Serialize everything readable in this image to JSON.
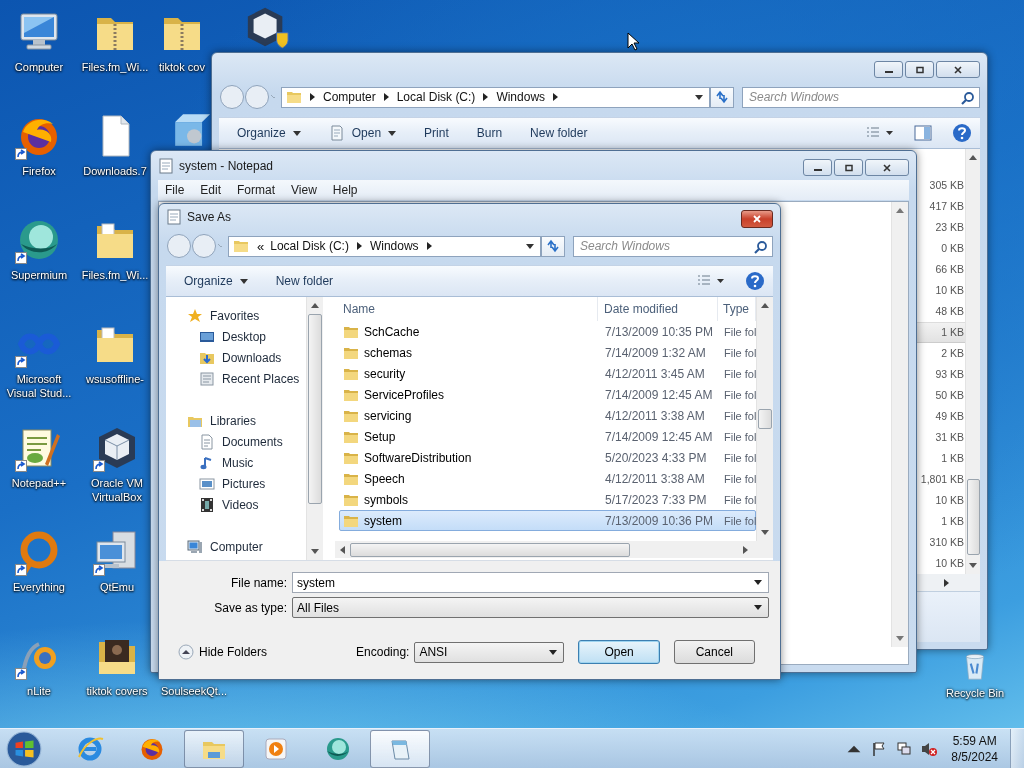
{
  "desktop_icons": [
    {
      "label": "Computer",
      "kind": "computer",
      "shortcut": false
    },
    {
      "label": "Firefox",
      "kind": "firefox",
      "shortcut": true
    },
    {
      "label": "Supermium",
      "kind": "supermium",
      "shortcut": true
    },
    {
      "label": "Microsoft Visual Stud...",
      "kind": "vs",
      "shortcut": true
    },
    {
      "label": "Notepad++",
      "kind": "notepadpp",
      "shortcut": true
    },
    {
      "label": "Everything",
      "kind": "everything",
      "shortcut": true
    },
    {
      "label": "nLite",
      "kind": "nlite",
      "shortcut": true
    },
    {
      "label": "Files.fm_Wi...",
      "kind": "zip-folder",
      "shortcut": false
    },
    {
      "label": "Downloads.7",
      "kind": "file",
      "shortcut": false
    },
    {
      "label": "Files.fm_Wi...",
      "kind": "folder",
      "shortcut": false
    },
    {
      "label": "wsusoffline-",
      "kind": "folder",
      "shortcut": false
    },
    {
      "label": "Oracle VM VirtualBox",
      "kind": "virtualbox",
      "shortcut": true
    },
    {
      "label": "QtEmu",
      "kind": "qtemu",
      "shortcut": true
    },
    {
      "label": "tiktok covers",
      "kind": "photo-folder",
      "shortcut": false
    },
    {
      "label": "tiktok cov",
      "kind": "zip-folder",
      "shortcut": false
    },
    {
      "kind": "installer",
      "shortcut": false
    },
    {
      "label": "SoulseekQt..."
    },
    {
      "kind": "cube-shield",
      "shortcut": false
    },
    {
      "label": "Recycle Bin",
      "kind": "recycle-bin",
      "shortcut": false
    }
  ],
  "explorer": {
    "breadcrumb": [
      "Computer",
      "Local Disk (C:)",
      "Windows"
    ],
    "search_placeholder": "Search Windows",
    "toolbar": [
      {
        "label": "Organize",
        "dropdown": true,
        "icon": false
      },
      {
        "label": "Open",
        "dropdown": true,
        "icon": true
      },
      {
        "label": "Print",
        "dropdown": false,
        "icon": false
      },
      {
        "label": "Burn",
        "dropdown": false,
        "icon": false
      },
      {
        "label": "New folder",
        "dropdown": false,
        "icon": false
      }
    ],
    "sizes": [
      {
        "text": "305 KB",
        "selected": false
      },
      {
        "text": "417 KB",
        "selected": false
      },
      {
        "text": "23 KB",
        "selected": false
      },
      {
        "text": "0 KB",
        "selected": false
      },
      {
        "text": "66 KB",
        "selected": false
      },
      {
        "text": "10 KB",
        "selected": false
      },
      {
        "text": "48 KB",
        "selected": false
      },
      {
        "text": "1 KB",
        "selected": true
      },
      {
        "text": "2 KB",
        "selected": false
      },
      {
        "text": "93 KB",
        "selected": false
      },
      {
        "text": "50 KB",
        "selected": false
      },
      {
        "text": "49 KB",
        "selected": false
      },
      {
        "text": "31 KB",
        "selected": false
      },
      {
        "text": "1 KB",
        "selected": false
      },
      {
        "text": "1,801 KB",
        "selected": false
      },
      {
        "text": "10 KB",
        "selected": false
      },
      {
        "text": "1 KB",
        "selected": false
      },
      {
        "text": "310 KB",
        "selected": false
      },
      {
        "text": "10 KB",
        "selected": false
      }
    ]
  },
  "notepad": {
    "title": "system - Notepad",
    "menu": [
      "File",
      "Edit",
      "Format",
      "View",
      "Help"
    ]
  },
  "save_as": {
    "title": "Save As",
    "overflow": "«",
    "breadcrumb": [
      "Local Disk (C:)",
      "Windows"
    ],
    "search_placeholder": "Search Windows",
    "toolbar": [
      {
        "label": "Organize",
        "dropdown": true
      },
      {
        "label": "New folder",
        "dropdown": false
      }
    ],
    "nav": [
      {
        "label": "Favorites",
        "kind": "favorites",
        "children": [
          {
            "label": "Desktop",
            "kind": "desktop"
          },
          {
            "label": "Downloads",
            "kind": "downloads"
          },
          {
            "label": "Recent Places",
            "kind": "recent"
          }
        ]
      },
      {
        "label": "Libraries",
        "kind": "libraries",
        "children": [
          {
            "label": "Documents",
            "kind": "documents"
          },
          {
            "label": "Music",
            "kind": "music"
          },
          {
            "label": "Pictures",
            "kind": "pictures"
          },
          {
            "label": "Videos",
            "kind": "videos"
          }
        ]
      },
      {
        "label": "Computer",
        "kind": "computer"
      }
    ],
    "columns": [
      "Name",
      "Date modified",
      "Type"
    ],
    "rows": [
      {
        "name": "SchCache",
        "date": "7/13/2009 10:35 PM",
        "type": "File fol",
        "selected": false
      },
      {
        "name": "schemas",
        "date": "7/14/2009 1:32 AM",
        "type": "File fol",
        "selected": false
      },
      {
        "name": "security",
        "date": "4/12/2011 3:45 AM",
        "type": "File fol",
        "selected": false
      },
      {
        "name": "ServiceProfiles",
        "date": "7/14/2009 12:45 AM",
        "type": "File fol",
        "selected": false
      },
      {
        "name": "servicing",
        "date": "4/12/2011 3:38 AM",
        "type": "File fol",
        "selected": false
      },
      {
        "name": "Setup",
        "date": "7/14/2009 12:45 AM",
        "type": "File fol",
        "selected": false
      },
      {
        "name": "SoftwareDistribution",
        "date": "5/20/2023 4:33 PM",
        "type": "File fol",
        "selected": false
      },
      {
        "name": "Speech",
        "date": "4/12/2011 3:38 AM",
        "type": "File fol",
        "selected": false
      },
      {
        "name": "symbols",
        "date": "5/17/2023 7:33 PM",
        "type": "File fol",
        "selected": false
      },
      {
        "name": "system",
        "date": "7/13/2009 10:36 PM",
        "type": "File fol",
        "selected": true
      }
    ],
    "file_name_label": "File name:",
    "file_name": "system",
    "type_label": "Save as type:",
    "type": "All Files",
    "hide_folders": "Hide Folders",
    "encoding_label": "Encoding:",
    "encoding": "ANSI",
    "buttons": [
      {
        "label": "Open",
        "default": true
      },
      {
        "label": "Cancel",
        "default": false
      }
    ]
  },
  "taskbar": {
    "apps": [
      {
        "kind": "ie",
        "running": false,
        "active": false
      },
      {
        "kind": "firefox",
        "running": false,
        "active": false
      },
      {
        "kind": "explorer",
        "running": true,
        "active": false
      },
      {
        "kind": "media",
        "running": false,
        "active": false
      },
      {
        "kind": "supermium",
        "running": false,
        "active": false
      },
      {
        "kind": "notepad",
        "running": true,
        "active": true
      }
    ],
    "time": "5:59 AM",
    "date": "8/5/2024"
  }
}
